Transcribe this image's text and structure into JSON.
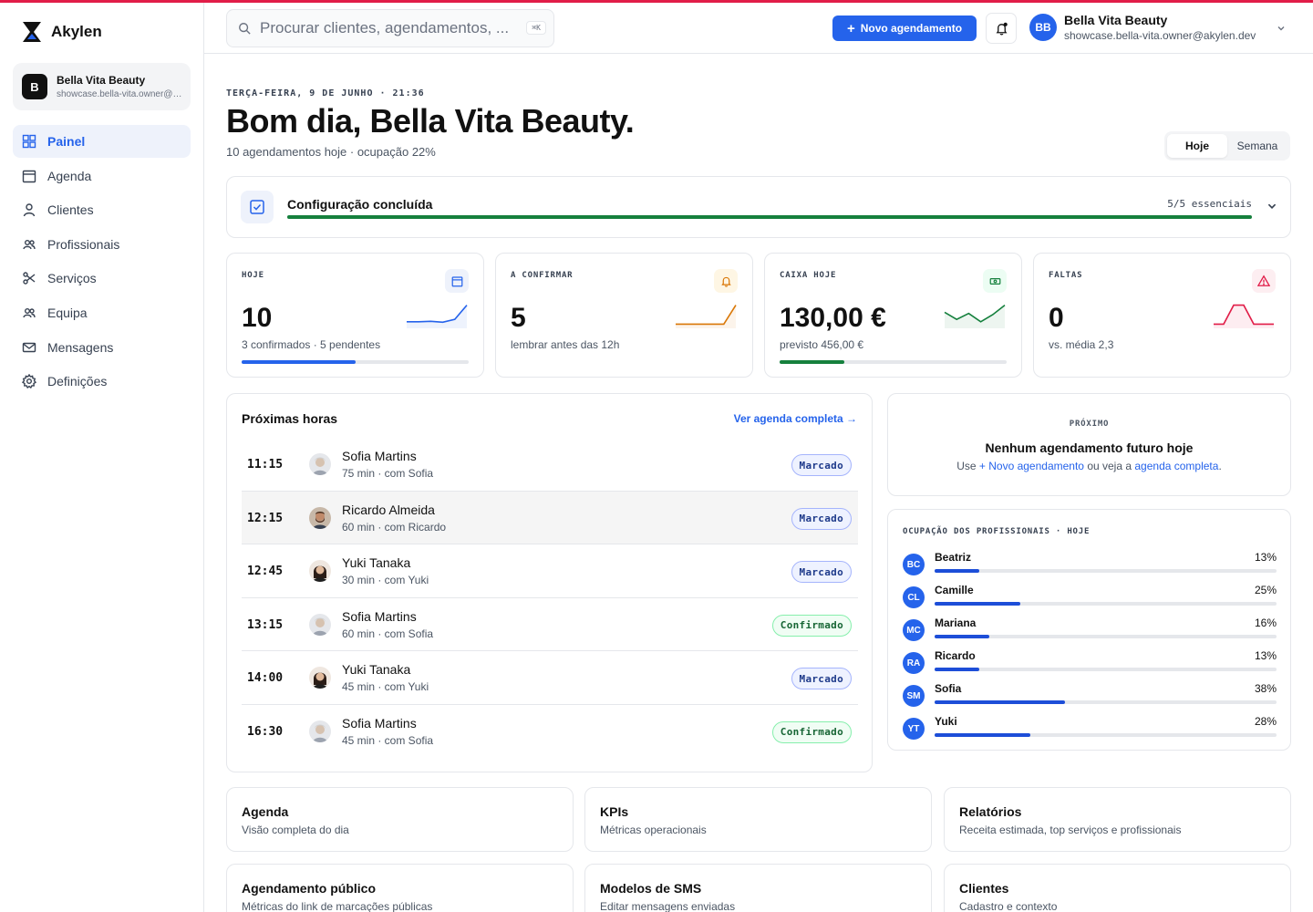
{
  "brand": {
    "name": "Akylen"
  },
  "tenant": {
    "initial": "B",
    "name": "Bella Vita Beauty",
    "email": "showcase.bella-vita.owner@akylen.dev"
  },
  "nav": [
    {
      "label": "Painel",
      "icon": "dashboard-icon",
      "active": true
    },
    {
      "label": "Agenda",
      "icon": "calendar-icon"
    },
    {
      "label": "Clientes",
      "icon": "user-icon"
    },
    {
      "label": "Profissionais",
      "icon": "users-icon"
    },
    {
      "label": "Serviços",
      "icon": "scissors-icon"
    },
    {
      "label": "Equipa",
      "icon": "team-icon"
    },
    {
      "label": "Mensagens",
      "icon": "mail-icon"
    },
    {
      "label": "Definições",
      "icon": "gear-icon"
    }
  ],
  "header": {
    "search_placeholder": "Procurar clientes, agendamentos, ...",
    "search_shortcut": "⌘K",
    "new_button": "Novo agendamento",
    "user": {
      "initials": "BB",
      "name": "Bella Vita Beauty",
      "email": "showcase.bella-vita.owner@akylen.dev"
    }
  },
  "greeting": {
    "date": "TERÇA-FEIRA, 9 DE JUNHO · 21:36",
    "title": "Bom dia, Bella Vita Beauty.",
    "subtitle": "10 agendamentos hoje · ocupação 22%",
    "range_tabs": [
      {
        "label": "Hoje",
        "active": true
      },
      {
        "label": "Semana",
        "active": false
      }
    ]
  },
  "setup": {
    "title": "Configuração concluída",
    "count": "5/5 essenciais",
    "progress": 1.0
  },
  "kpis": [
    {
      "label": "HOJE",
      "value": "10",
      "sub": "3 confirmados · 5 pendentes",
      "icon": "calendar-icon",
      "color": "#2563eb",
      "progress": 0.5,
      "spark": [
        0.2,
        0.2,
        0.22,
        0.18,
        0.3,
        0.9
      ]
    },
    {
      "label": "A CONFIRMAR",
      "value": "5",
      "sub": "lembrar antes das 12h",
      "icon": "bell-icon",
      "color": "#d97706",
      "progress": null,
      "spark": [
        0.1,
        0.1,
        0.1,
        0.1,
        0.1,
        0.9
      ]
    },
    {
      "label": "CAIXA HOJE",
      "value": "130,00 €",
      "sub": "previsto 456,00 €",
      "icon": "cash-icon",
      "color": "#15803d",
      "progress": 0.285,
      "spark": [
        0.6,
        0.3,
        0.55,
        0.2,
        0.5,
        0.9
      ]
    },
    {
      "label": "FALTAS",
      "value": "0",
      "sub": "vs. média 2,3",
      "icon": "alert-icon",
      "color": "#e11d48",
      "progress": null,
      "spark": [
        0.1,
        0.1,
        0.9,
        0.9,
        0.1,
        0.1,
        0.1
      ]
    }
  ],
  "upcoming": {
    "title": "Próximas horas",
    "link": "Ver agenda completa →",
    "items": [
      {
        "time": "11:15",
        "name": "Sofia Martins",
        "meta": "75 min · com Sofia",
        "status": "Marcado",
        "kind": "marcado",
        "avatar": "older-woman"
      },
      {
        "time": "12:15",
        "name": "Ricardo Almeida",
        "meta": "60 min · com Ricardo",
        "status": "Marcado",
        "kind": "marcado",
        "avatar": "bearded-man"
      },
      {
        "time": "12:45",
        "name": "Yuki Tanaka",
        "meta": "30 min · com Yuki",
        "status": "Marcado",
        "kind": "marcado",
        "avatar": "dark-hair-woman"
      },
      {
        "time": "13:15",
        "name": "Sofia Martins",
        "meta": "60 min · com Sofia",
        "status": "Confirmado",
        "kind": "confirmado",
        "avatar": "older-woman"
      },
      {
        "time": "14:00",
        "name": "Yuki Tanaka",
        "meta": "45 min · com Yuki",
        "status": "Marcado",
        "kind": "marcado",
        "avatar": "dark-hair-woman"
      },
      {
        "time": "16:30",
        "name": "Sofia Martins",
        "meta": "45 min · com Sofia",
        "status": "Confirmado",
        "kind": "confirmado",
        "avatar": "older-woman"
      }
    ]
  },
  "next": {
    "label": "PRÓXIMO",
    "title": "Nenhum agendamento futuro hoje",
    "sub_prefix": "Use",
    "sub_link1": "+ Novo agendamento",
    "sub_middle": "ou veja a",
    "sub_link2": "agenda completa",
    "sub_suffix": "."
  },
  "occupancy": {
    "label": "OCUPAÇÃO DOS PROFISSIONAIS · HOJE",
    "rows": [
      {
        "initials": "BC",
        "name": "Beatriz",
        "pct": "13%",
        "value": 0.13
      },
      {
        "initials": "CL",
        "name": "Camille",
        "pct": "25%",
        "value": 0.25
      },
      {
        "initials": "MC",
        "name": "Mariana",
        "pct": "16%",
        "value": 0.16
      },
      {
        "initials": "RA",
        "name": "Ricardo",
        "pct": "13%",
        "value": 0.13
      },
      {
        "initials": "SM",
        "name": "Sofia",
        "pct": "38%",
        "value": 0.38
      },
      {
        "initials": "YT",
        "name": "Yuki",
        "pct": "28%",
        "value": 0.28
      }
    ]
  },
  "tiles": [
    {
      "title": "Agenda",
      "desc": "Visão completa do dia"
    },
    {
      "title": "KPIs",
      "desc": "Métricas operacionais"
    },
    {
      "title": "Relatórios",
      "desc": "Receita estimada, top serviços e profissionais"
    },
    {
      "title": "Agendamento público",
      "desc": "Métricas do link de marcações públicas"
    },
    {
      "title": "Modelos de SMS",
      "desc": "Editar mensagens enviadas"
    },
    {
      "title": "Clientes",
      "desc": "Cadastro e contexto"
    }
  ]
}
